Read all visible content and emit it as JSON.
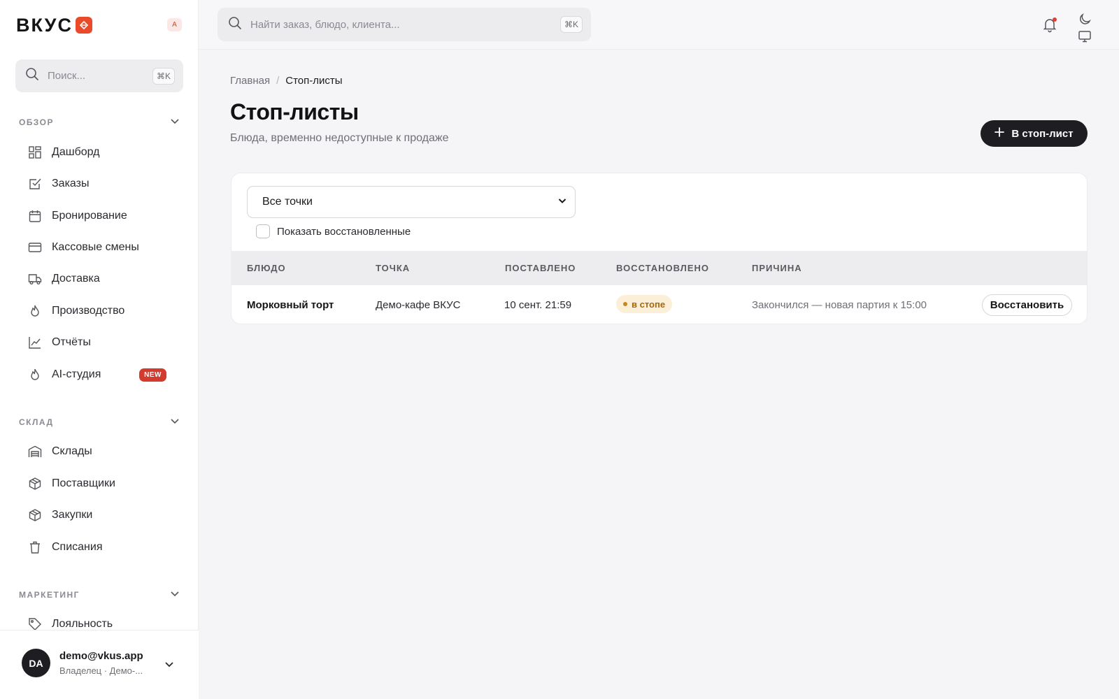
{
  "brand": {
    "name": "ВКУС",
    "lang": "A"
  },
  "sidebar": {
    "search": {
      "placeholder": "Поиск...",
      "shortcut": "⌘K"
    },
    "sections": [
      {
        "label": "ОБЗОР",
        "items": [
          {
            "label": "Дашборд",
            "icon": "grid-icon"
          },
          {
            "label": "Заказы",
            "icon": "check-square-icon"
          },
          {
            "label": "Бронирование",
            "icon": "calendar-icon"
          },
          {
            "label": "Кассовые смены",
            "icon": "credit-card-icon"
          },
          {
            "label": "Доставка",
            "icon": "truck-icon"
          },
          {
            "label": "Производство",
            "icon": "flame-icon"
          },
          {
            "label": "Отчёты",
            "icon": "chart-line-icon"
          },
          {
            "label": "AI-студия",
            "icon": "flame-icon",
            "badge": "NEW"
          }
        ]
      },
      {
        "label": "СКЛАД",
        "items": [
          {
            "label": "Склады",
            "icon": "warehouse-icon"
          },
          {
            "label": "Поставщики",
            "icon": "package-icon"
          },
          {
            "label": "Закупки",
            "icon": "package-icon"
          },
          {
            "label": "Списания",
            "icon": "trash-icon"
          }
        ]
      },
      {
        "label": "МАРКЕТИНГ",
        "items": [
          {
            "label": "Лояльность",
            "icon": "tag-icon"
          }
        ]
      }
    ]
  },
  "user": {
    "initials": "DA",
    "email": "demo@vkus.app",
    "role": "Владелец · Демо-..."
  },
  "topbar": {
    "search": {
      "placeholder": "Найти заказ, блюдо, клиента...",
      "shortcut": "⌘K"
    }
  },
  "breadcrumb": {
    "home": "Главная",
    "separator": "/",
    "current": "Стоп-листы"
  },
  "page": {
    "title": "Стоп-листы",
    "subtitle": "Блюда, временно недоступные к продаже",
    "add_button": "В стоп-лист"
  },
  "filters": {
    "location_selected": "Все точки",
    "show_restored_label": "Показать восстановленные",
    "show_restored_checked": false
  },
  "table": {
    "columns": [
      "БЛЮДО",
      "ТОЧКА",
      "ПОСТАВЛЕНО",
      "ВОССТАНОВЛЕНО",
      "ПРИЧИНА"
    ],
    "rows": [
      {
        "dish": "Морковный торт",
        "location": "Демо-кафе ВКУС",
        "placed": "10 сент. 21:59",
        "status": "в стопе",
        "reason": "Закончился — новая партия к 15:00",
        "action": "Восстановить"
      }
    ]
  },
  "colors": {
    "accent": "#1d1d22",
    "brand": "#ea4a2a",
    "badge_new": "#d23b2e",
    "status_bg": "#fbefd7",
    "status_text": "#a5660c"
  }
}
